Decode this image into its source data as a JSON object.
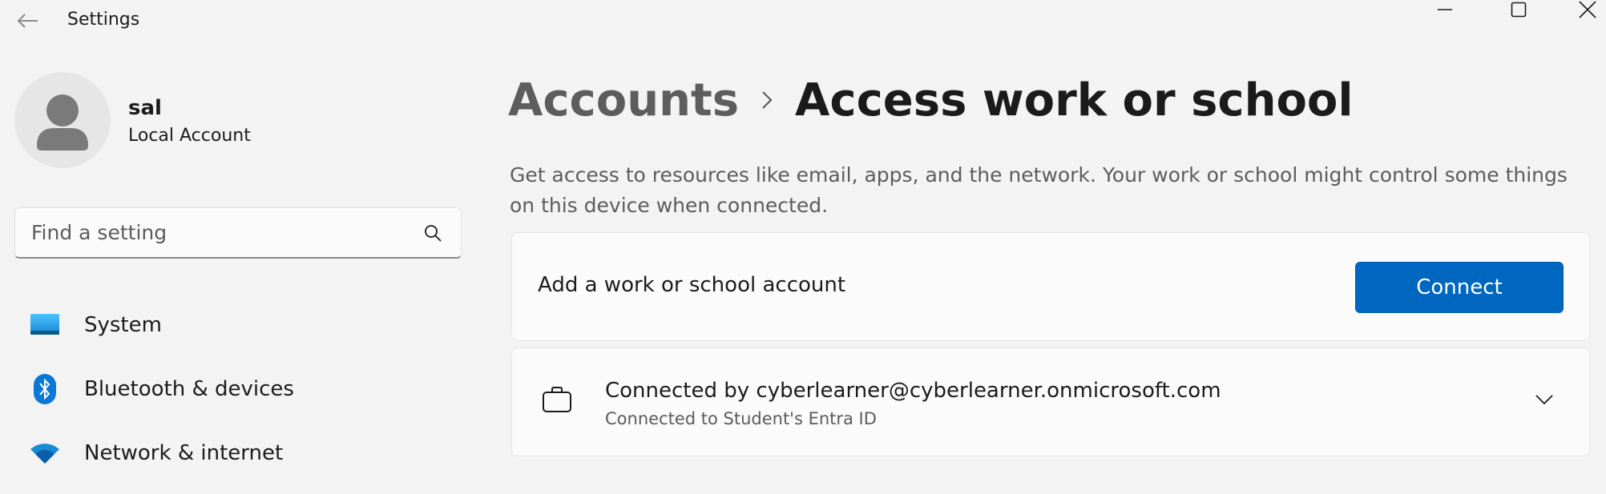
{
  "window": {
    "title": "Settings"
  },
  "user": {
    "name": "sal",
    "account_type": "Local Account"
  },
  "search": {
    "placeholder": "Find a setting",
    "value": ""
  },
  "sidebar": {
    "items": [
      {
        "label": "System",
        "icon": "system-icon"
      },
      {
        "label": "Bluetooth & devices",
        "icon": "bluetooth-icon"
      },
      {
        "label": "Network & internet",
        "icon": "wifi-icon"
      }
    ]
  },
  "breadcrumb": {
    "parent": "Accounts",
    "current": "Access work or school"
  },
  "main": {
    "description": "Get access to resources like email, apps, and the network. Your work or school might control some things on this device when connected.",
    "add_account": {
      "label": "Add a work or school account",
      "button_label": "Connect"
    },
    "connected_account": {
      "title": "Connected by cyberlearner@cyberlearner.onmicrosoft.com",
      "subtitle": "Connected to Student's Entra ID",
      "icon": "briefcase-icon"
    }
  },
  "colors": {
    "accent": "#0067c0",
    "background": "#f3f3f3",
    "card": "#fbfbfb"
  }
}
